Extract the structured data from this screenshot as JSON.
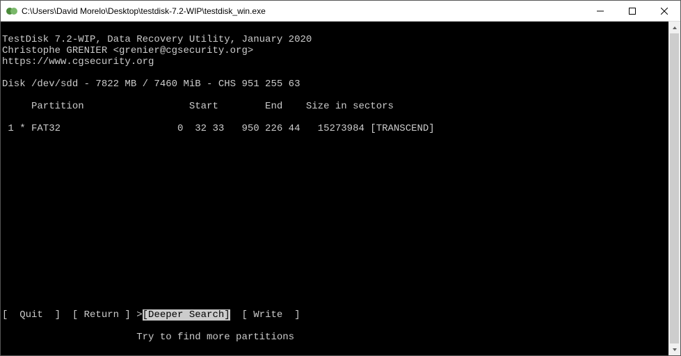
{
  "window": {
    "title": "C:\\Users\\David Morelo\\Desktop\\testdisk-7.2-WIP\\testdisk_win.exe"
  },
  "header": {
    "line1": "TestDisk 7.2-WIP, Data Recovery Utility, January 2020",
    "line2": "Christophe GRENIER <grenier@cgsecurity.org>",
    "line3": "https://www.cgsecurity.org"
  },
  "disk_line": "Disk /dev/sdd - 7822 MB / 7460 MiB - CHS 951 255 63",
  "table_header": "     Partition                  Start        End    Size in sectors",
  "partition_row": " 1 * FAT32                    0  32 33   950 226 44   15273984 [TRANSCEND]",
  "menu": {
    "prefix": "[  Quit  ]  [ Return ] ",
    "cursor": ">",
    "selected": "[Deeper Search]",
    "suffix": "  [ Write  ]"
  },
  "hint": "                       Try to find more partitions"
}
